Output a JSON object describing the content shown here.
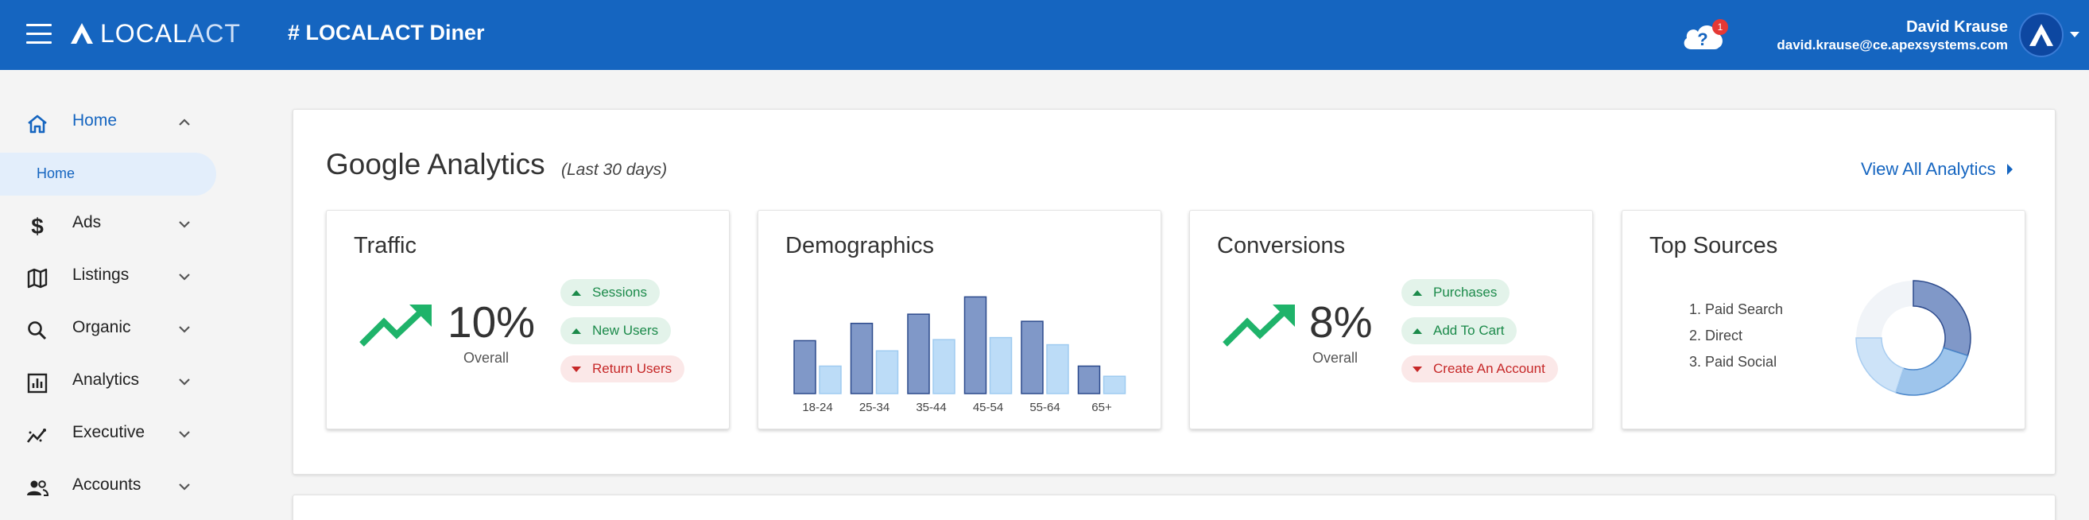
{
  "header": {
    "logo": {
      "part1": "LOCAL",
      "part2": "ACT"
    },
    "page_title": "# LOCALACT Diner",
    "notification_count": "1",
    "user": {
      "name": "David Krause",
      "email": "david.krause@ce.apexsystems.com"
    }
  },
  "sidebar": {
    "items": [
      {
        "label": "Home",
        "icon": "home-icon",
        "expanded": true,
        "active": true
      },
      {
        "label": "Ads",
        "icon": "dollar-icon"
      },
      {
        "label": "Listings",
        "icon": "map-icon"
      },
      {
        "label": "Organic",
        "icon": "search-icon"
      },
      {
        "label": "Analytics",
        "icon": "bar-chart-icon"
      },
      {
        "label": "Executive",
        "icon": "trend-line-icon"
      },
      {
        "label": "Accounts",
        "icon": "people-icon"
      }
    ],
    "subitem": {
      "label": "Home"
    }
  },
  "analytics": {
    "title": "Google Analytics",
    "subtitle": "(Last 30 days)",
    "view_all": "View All Analytics",
    "traffic": {
      "title": "Traffic",
      "value": "10%",
      "caption": "Overall",
      "pills": [
        {
          "label": "Sessions",
          "direction": "up"
        },
        {
          "label": "New Users",
          "direction": "up"
        },
        {
          "label": "Return Users",
          "direction": "down"
        }
      ]
    },
    "demographics": {
      "title": "Demographics"
    },
    "conversions": {
      "title": "Conversions",
      "value": "8%",
      "caption": "Overall",
      "pills": [
        {
          "label": "Purchases",
          "direction": "up"
        },
        {
          "label": "Add To Cart",
          "direction": "up"
        },
        {
          "label": "Create An Account",
          "direction": "down"
        }
      ]
    },
    "top_sources": {
      "title": "Top Sources",
      "items": [
        "1. Paid Search",
        "2. Direct",
        "3. Paid Social"
      ]
    }
  },
  "colors": {
    "primary": "#1565c0",
    "up": "#1b8a4a",
    "down": "#c62828",
    "trend_arrow": "#1fb36a",
    "bar_dark": "#8098c8",
    "bar_light": "#bcdcf7"
  },
  "chart_data": [
    {
      "type": "bar",
      "categories": [
        "18-24",
        "25-34",
        "35-44",
        "45-54",
        "55-64",
        "65+"
      ],
      "series": [
        {
          "values": [
            52,
            69,
            78,
            95,
            71,
            27
          ]
        },
        {
          "values": [
            27,
            42,
            53,
            55,
            48,
            17
          ]
        }
      ]
    },
    {
      "type": "pie",
      "labels": [
        "Paid Search",
        "Direct",
        "Paid Social"
      ],
      "values": [
        30,
        25,
        20
      ]
    }
  ]
}
